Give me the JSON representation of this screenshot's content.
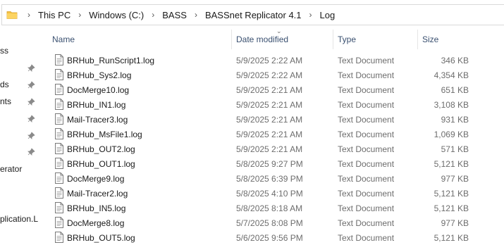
{
  "breadcrumb": [
    "This PC",
    "Windows (C:)",
    "BASS",
    "BASSnet Replicator 4.1",
    "Log"
  ],
  "nav_pane": {
    "items": [
      {
        "label": "ss",
        "pinned": false
      },
      {
        "label": "",
        "pinned": true
      },
      {
        "label": "ds",
        "pinned": true
      },
      {
        "label": "nts",
        "pinned": true
      },
      {
        "label": "",
        "pinned": true
      },
      {
        "label": "",
        "pinned": true
      },
      {
        "label": "",
        "pinned": true
      },
      {
        "label": "erator",
        "pinned": false
      },
      {
        "label": "",
        "pinned": false
      },
      {
        "label": "plication.L",
        "pinned": false
      }
    ]
  },
  "columns": {
    "name": "Name",
    "date": "Date modified",
    "type": "Type",
    "size": "Size"
  },
  "files": [
    {
      "name": "BRHub_RunScript1.log",
      "date": "5/9/2025 2:22 AM",
      "type": "Text Document",
      "size": "346 KB"
    },
    {
      "name": "BRHub_Sys2.log",
      "date": "5/9/2025 2:22 AM",
      "type": "Text Document",
      "size": "4,354 KB"
    },
    {
      "name": "DocMerge10.log",
      "date": "5/9/2025 2:21 AM",
      "type": "Text Document",
      "size": "651 KB"
    },
    {
      "name": "BRHub_IN1.log",
      "date": "5/9/2025 2:21 AM",
      "type": "Text Document",
      "size": "3,108 KB"
    },
    {
      "name": "Mail-Tracer3.log",
      "date": "5/9/2025 2:21 AM",
      "type": "Text Document",
      "size": "931 KB"
    },
    {
      "name": "BRHub_MsFile1.log",
      "date": "5/9/2025 2:21 AM",
      "type": "Text Document",
      "size": "1,069 KB"
    },
    {
      "name": "BRHub_OUT2.log",
      "date": "5/9/2025 2:21 AM",
      "type": "Text Document",
      "size": "571 KB"
    },
    {
      "name": "BRHub_OUT1.log",
      "date": "5/8/2025 9:27 PM",
      "type": "Text Document",
      "size": "5,121 KB"
    },
    {
      "name": "DocMerge9.log",
      "date": "5/8/2025 6:39 PM",
      "type": "Text Document",
      "size": "977 KB"
    },
    {
      "name": "Mail-Tracer2.log",
      "date": "5/8/2025 4:10 PM",
      "type": "Text Document",
      "size": "5,121 KB"
    },
    {
      "name": "BRHub_IN5.log",
      "date": "5/8/2025 8:18 AM",
      "type": "Text Document",
      "size": "5,121 KB"
    },
    {
      "name": "DocMerge8.log",
      "date": "5/7/2025 8:08 PM",
      "type": "Text Document",
      "size": "977 KB"
    },
    {
      "name": "BRHub_OUT5.log",
      "date": "5/6/2025 9:56 PM",
      "type": "Text Document",
      "size": "5,121 KB"
    }
  ],
  "colors": {
    "header_text": "#3a5070",
    "secondary_text": "#6d6d6d",
    "folder_yellow": "#f5c242"
  }
}
